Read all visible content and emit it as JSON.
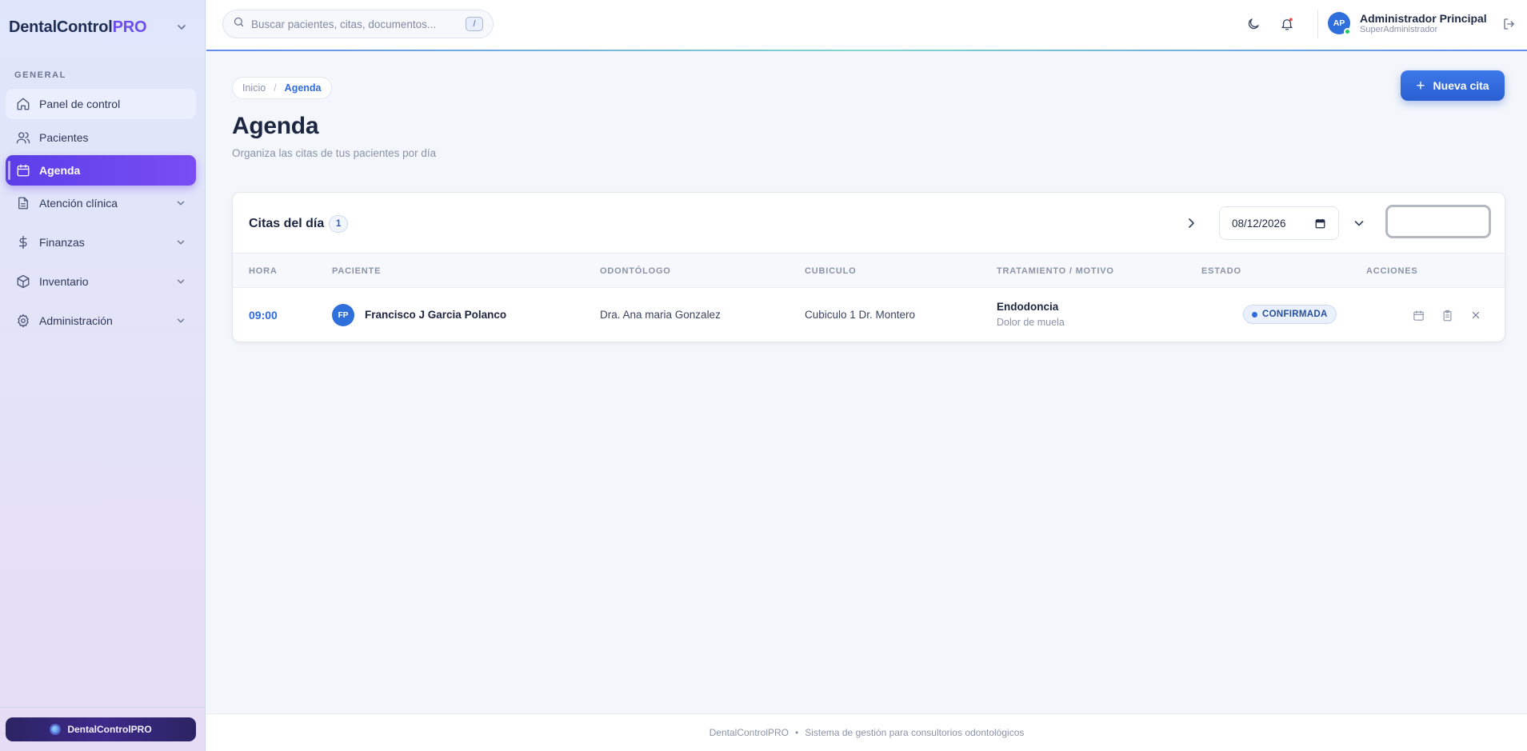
{
  "brand": {
    "name": "DentalControl",
    "suffix": "PRO"
  },
  "sidebar": {
    "section": "GENERAL",
    "items": [
      {
        "label": "Panel de control",
        "icon": "home-icon"
      },
      {
        "label": "Pacientes",
        "icon": "users-icon"
      },
      {
        "label": "Agenda",
        "icon": "calendar-icon",
        "active": true
      },
      {
        "label": "Atención clínica",
        "icon": "file-icon",
        "expandable": true
      },
      {
        "label": "Finanzas",
        "icon": "dollar-icon",
        "expandable": true
      },
      {
        "label": "Inventario",
        "icon": "box-icon",
        "expandable": true
      },
      {
        "label": "Administración",
        "icon": "settings-icon",
        "expandable": true
      }
    ],
    "footer_badge": "DentalControlPRO"
  },
  "topbar": {
    "search_placeholder": "Buscar pacientes, citas, documentos...",
    "search_shortcut": "/",
    "user": {
      "initials": "AP",
      "name": "Administrador Principal",
      "role": "SuperAdministrador"
    }
  },
  "breadcrumb": {
    "home": "Inicio",
    "separator": "/",
    "current": "Agenda"
  },
  "page": {
    "title": "Agenda",
    "subtitle": "Organiza las citas de tus pacientes por día",
    "new_button": "Nueva cita"
  },
  "card": {
    "title": "Citas del día",
    "count": "1",
    "date": "08/12/2026",
    "columns": [
      "HORA",
      "PACIENTE",
      "ODONTÓLOGO",
      "CUBICULO",
      "TRATAMIENTO / MOTIVO",
      "ESTADO",
      "ACCIONES"
    ],
    "rows": [
      {
        "time": "09:00",
        "initials": "FP",
        "patient": "Francisco J Garcia Polanco",
        "dentist": "Dra. Ana maria Gonzalez",
        "cubicle": "Cubiculo 1 Dr. Montero",
        "treatment": "Endodoncia",
        "reason": "Dolor de muela",
        "status": "CONFIRMADA"
      }
    ]
  },
  "footer": {
    "app": "DentalControlPRO",
    "bullet": "•",
    "tagline": "Sistema de gestión para consultorios odontológicos"
  },
  "colors": {
    "primary": "#2f6bdc",
    "accent": "#6d4cf0",
    "active_nav": "#5b3ee8",
    "status_bg": "#eaf1fd"
  }
}
